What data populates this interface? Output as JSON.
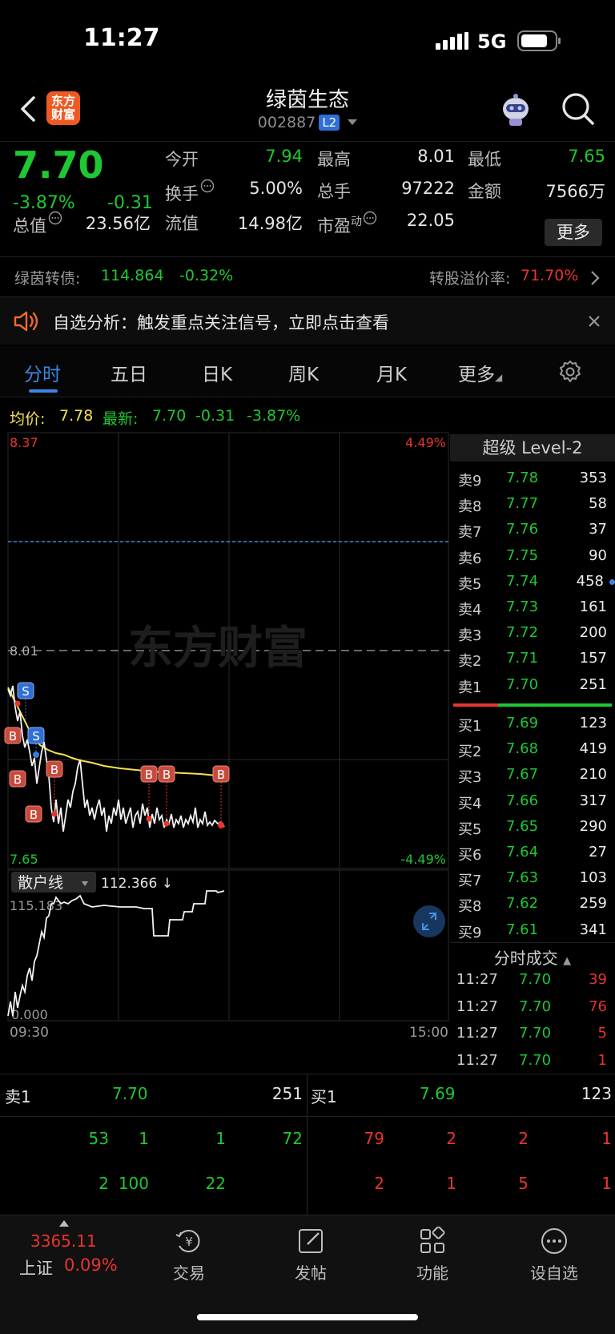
{
  "status_bar": {
    "time": "11:27",
    "network": "5G"
  },
  "header": {
    "app_logo": "东方\n财富",
    "stock_name": "绿茵生态",
    "stock_code": "002887",
    "level_badge": "L2"
  },
  "quote": {
    "last_price": "7.70",
    "pct_change": "-3.87%",
    "abs_change": "-0.31",
    "fields": [
      {
        "label": "今开",
        "value": "7.94",
        "color": "green"
      },
      {
        "label": "最高",
        "value": "8.01",
        "color": "white"
      },
      {
        "label": "最低",
        "value": "7.65",
        "color": "green"
      },
      {
        "label": "换手",
        "value": "5.00%",
        "color": "white"
      },
      {
        "label": "总手",
        "value": "97222",
        "color": "white"
      },
      {
        "label": "金额",
        "value": "7566万",
        "color": "white"
      },
      {
        "label": "总值",
        "value": "23.56亿",
        "color": "white"
      },
      {
        "label": "流值",
        "value": "14.98亿",
        "color": "white"
      },
      {
        "label": "市盈",
        "value": "22.05",
        "color": "white"
      }
    ],
    "pe_sup": "动",
    "more_label": "更多"
  },
  "bond": {
    "label": "绿茵转债:",
    "price": "114.864",
    "change": "-0.32%",
    "premium_label": "转股溢价率:",
    "premium_value": "71.70%"
  },
  "alert": {
    "text": "自选分析：触发重点关注信号，立即点击查看"
  },
  "tabs": [
    "分时",
    "五日",
    "日K",
    "周K",
    "月K",
    "更多"
  ],
  "info_bar": {
    "avg_label": "均价:",
    "avg_value": "7.78",
    "latest_label": "最新:",
    "latest_value": "7.70",
    "change": "-0.31",
    "pct": "-3.87%"
  },
  "chart": {
    "y_top": "8.37",
    "y_bottom": "7.65",
    "pct_top": "4.49%",
    "pct_bottom": "-4.49%",
    "mid_label": "8.01",
    "watermark": "东方财富",
    "sub_indicator": "散户线",
    "sub_value": "112.366 ↓",
    "sub_top": "115.183",
    "sub_bottom": "0.000",
    "time_start": "09:30",
    "time_end": "15:00",
    "markers": [
      "S",
      "S",
      "B",
      "B",
      "B",
      "B",
      "B",
      "B",
      "B"
    ]
  },
  "order_book": {
    "title": "超级 Level-2",
    "asks": [
      {
        "label": "卖9",
        "price": "7.78",
        "vol": "353"
      },
      {
        "label": "卖8",
        "price": "7.77",
        "vol": "58"
      },
      {
        "label": "卖7",
        "price": "7.76",
        "vol": "37"
      },
      {
        "label": "卖6",
        "price": "7.75",
        "vol": "90"
      },
      {
        "label": "卖5",
        "price": "7.74",
        "vol": "458"
      },
      {
        "label": "卖4",
        "price": "7.73",
        "vol": "161"
      },
      {
        "label": "卖3",
        "price": "7.72",
        "vol": "200"
      },
      {
        "label": "卖2",
        "price": "7.71",
        "vol": "157"
      },
      {
        "label": "卖1",
        "price": "7.70",
        "vol": "251"
      }
    ],
    "bids": [
      {
        "label": "买1",
        "price": "7.69",
        "vol": "123"
      },
      {
        "label": "买2",
        "price": "7.68",
        "vol": "419"
      },
      {
        "label": "买3",
        "price": "7.67",
        "vol": "210"
      },
      {
        "label": "买4",
        "price": "7.66",
        "vol": "317"
      },
      {
        "label": "买5",
        "price": "7.65",
        "vol": "290"
      },
      {
        "label": "买6",
        "price": "7.64",
        "vol": "27"
      },
      {
        "label": "买7",
        "price": "7.63",
        "vol": "103"
      },
      {
        "label": "买8",
        "price": "7.62",
        "vol": "259"
      },
      {
        "label": "买9",
        "price": "7.61",
        "vol": "341"
      }
    ],
    "ticks_title": "分时成交",
    "ticks": [
      {
        "time": "11:27",
        "price": "7.70",
        "vol": "39"
      },
      {
        "time": "11:27",
        "price": "7.70",
        "vol": "76"
      },
      {
        "time": "11:27",
        "price": "7.70",
        "vol": "5"
      },
      {
        "time": "11:27",
        "price": "7.70",
        "vol": "1"
      }
    ]
  },
  "level1": {
    "ask_label": "卖1",
    "ask_price": "7.70",
    "ask_vol": "251",
    "bid_label": "买1",
    "bid_price": "7.69",
    "bid_vol": "123",
    "ask_queue": [
      [
        "53",
        "1",
        "1",
        "72"
      ],
      [
        "2",
        "100",
        "22",
        ""
      ]
    ],
    "bid_queue": [
      [
        "79",
        "2",
        "2",
        "1"
      ],
      [
        "2",
        "1",
        "5",
        "1"
      ]
    ]
  },
  "bottom_nav": {
    "index_value": "3365.11",
    "index_name": "上证",
    "index_pct": "0.09%",
    "items": [
      "交易",
      "发帖",
      "功能",
      "设自选"
    ]
  }
}
